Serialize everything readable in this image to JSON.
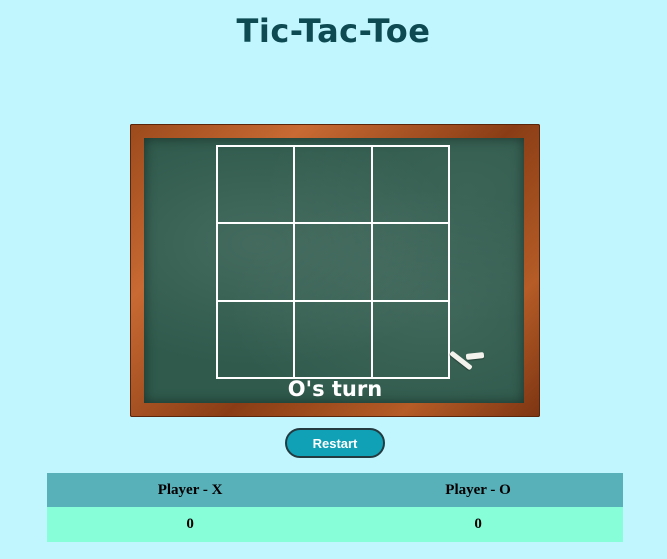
{
  "title": "Tic-Tac-Toe",
  "board": {
    "cells": [
      "",
      "",
      "",
      "",
      "",
      "",
      "",
      "",
      ""
    ],
    "turn_text": "O's turn"
  },
  "restart_label": "Restart",
  "scoreboard": {
    "headers": [
      "Player - X",
      "Player - O"
    ],
    "scores": [
      "0",
      "0"
    ]
  },
  "colors": {
    "background": "#c2f6fe",
    "chalkboard": "#2f5a4c",
    "frame": "#9c4a1c",
    "button": "#10a1b6",
    "header_row": "#58b0b9",
    "score_row": "#88fed8"
  }
}
